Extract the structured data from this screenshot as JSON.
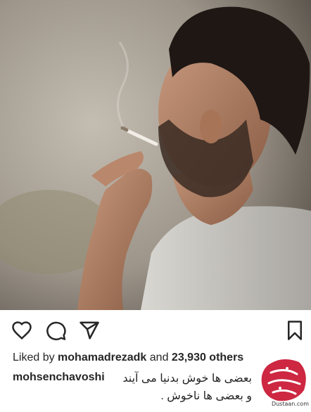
{
  "post": {
    "image_description_icon": "photo",
    "actions": {
      "like_icon": "heart-icon",
      "comment_icon": "comment-icon",
      "share_icon": "send-icon",
      "save_icon": "bookmark-icon"
    },
    "likes": {
      "prefix": "Liked by",
      "user": "mohamadrezadk",
      "connector": "and",
      "count": "23,930 others"
    },
    "caption": {
      "username": "mohsenchavoshi",
      "line1": "بعضی ها خوش بدنیا می آیند",
      "line2": "و بعضی ها ناخوش ."
    }
  },
  "watermark": {
    "site": "Dustaan.com"
  },
  "colors": {
    "text": "#262626",
    "watermark_red": "#c8102e"
  }
}
